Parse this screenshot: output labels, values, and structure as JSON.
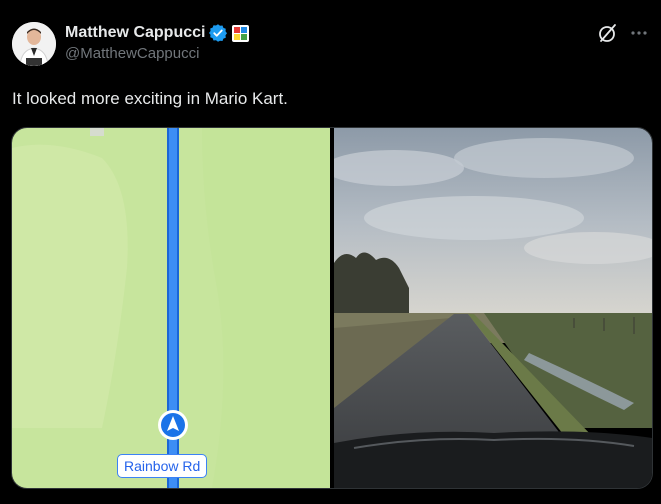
{
  "author": {
    "display_name": "Matthew Cappucci",
    "handle": "@MatthewCappucci"
  },
  "tweet": {
    "text": "It looked more exciting in Mario Kart."
  },
  "media": {
    "map_label": "Rainbow Rd"
  },
  "icons": {
    "verified": "verified-badge-icon",
    "affiliate": "affiliate-badge-icon",
    "grok": "grok-icon",
    "more": "more-icon"
  },
  "colors": {
    "background": "#000000",
    "text_primary": "#e7e9ea",
    "text_secondary": "#71767b",
    "verified_blue": "#1d9bf0",
    "map_green": "#c8e6a0",
    "route_blue": "#1a73e8"
  }
}
